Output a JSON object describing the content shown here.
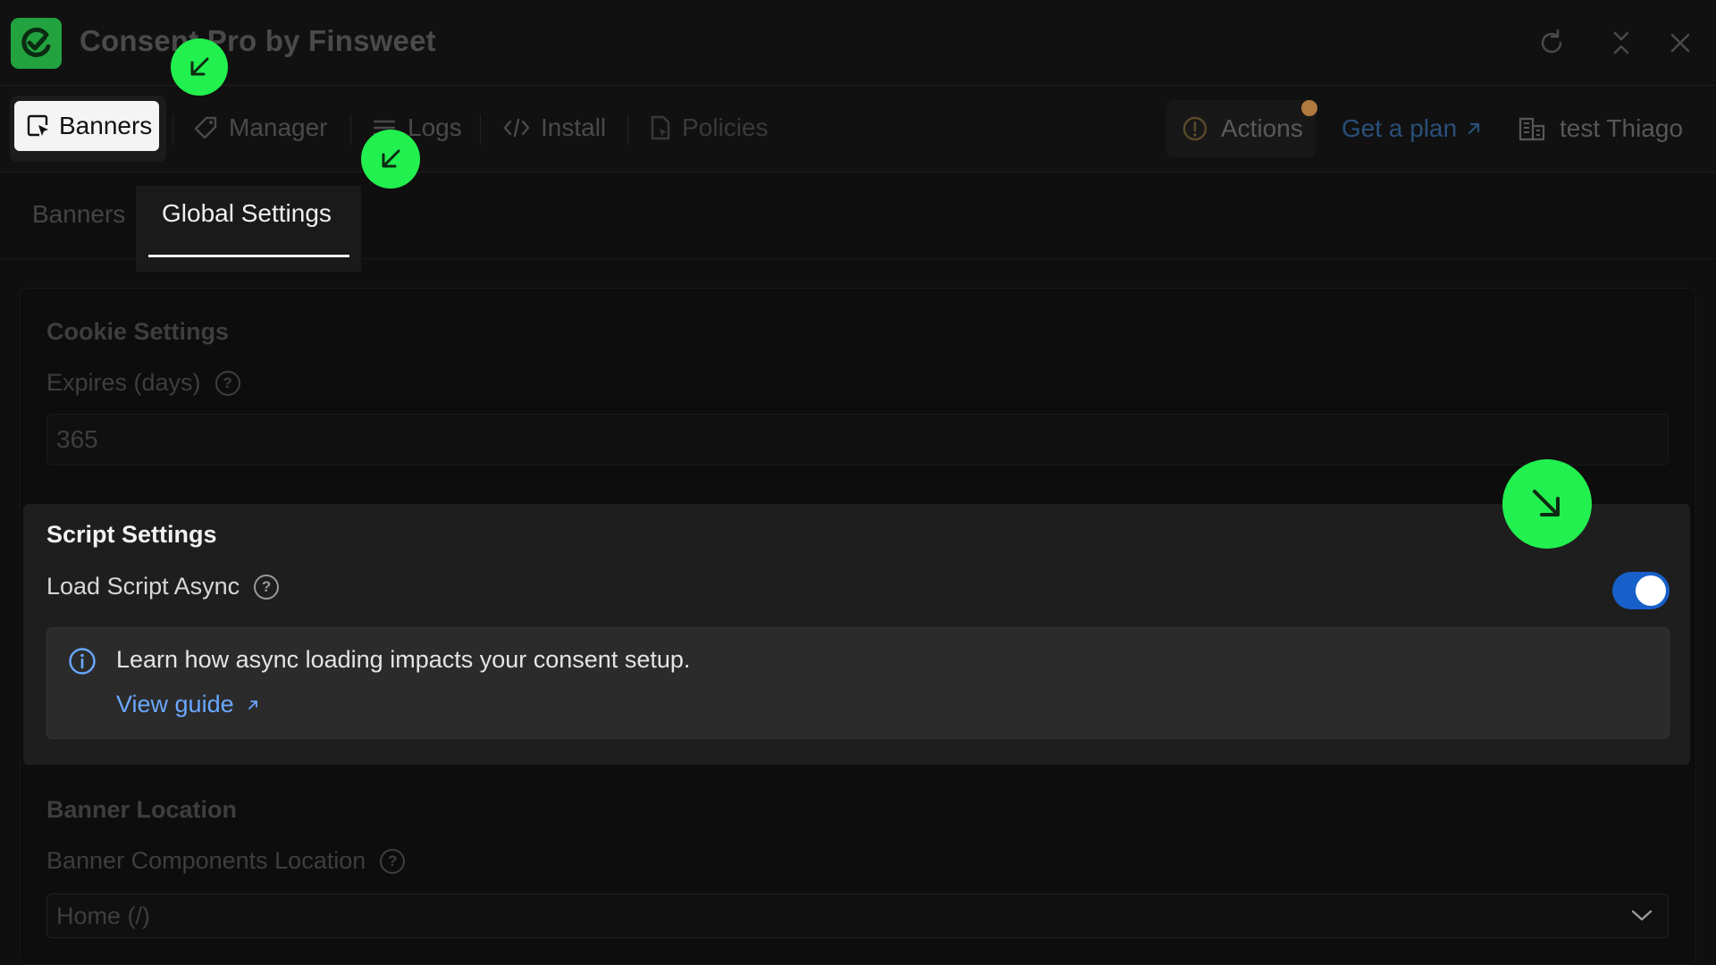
{
  "app": {
    "title": "Consent Pro by Finsweet"
  },
  "window_controls": [
    "refresh-icon",
    "collapse-icon",
    "close-icon"
  ],
  "nav": {
    "items": [
      {
        "label": "Banners",
        "icon": "banner-icon",
        "active": true
      },
      {
        "label": "Manager",
        "icon": "tag-icon"
      },
      {
        "label": "Logs",
        "icon": "list-icon"
      },
      {
        "label": "Install",
        "icon": "code-icon"
      },
      {
        "label": "Policies",
        "icon": "document-icon"
      }
    ],
    "actions_label": "Actions",
    "plan_label": "Get a plan",
    "site_label": "test Thiago"
  },
  "subtabs": [
    {
      "label": "Banners"
    },
    {
      "label": "Global Settings",
      "active": true
    }
  ],
  "cookie_settings": {
    "title": "Cookie Settings",
    "expires_label": "Expires (days)",
    "expires_value": "365"
  },
  "script_settings": {
    "title": "Script Settings",
    "async_label": "Load Script Async",
    "async_enabled": true,
    "info_text": "Learn how async loading impacts your consent setup.",
    "guide_link": "View guide"
  },
  "banner_location": {
    "title": "Banner Location",
    "components_label": "Banner Components Location",
    "selected": "Home (/)"
  },
  "colors": {
    "accent_green": "#22f04f",
    "toggle_blue": "#1760c9",
    "link_blue": "#6aa8ff",
    "logo_green": "#22a33f"
  }
}
